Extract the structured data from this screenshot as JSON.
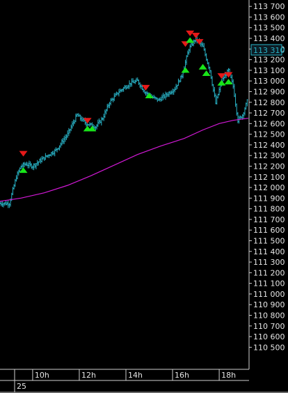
{
  "chart_data": {
    "type": "candlestick",
    "y_axis": {
      "ticks": [
        "113 700",
        "113 600",
        "113 500",
        "113 400",
        "113 300",
        "113 200",
        "113 100",
        "113 000",
        "112 900",
        "112 800",
        "112 700",
        "112 600",
        "112 500",
        "112 400",
        "112 300",
        "112 200",
        "112 100",
        "112 000",
        "111 900",
        "111 800",
        "111 700",
        "111 600",
        "111 500",
        "111 400",
        "111 300",
        "111 200",
        "111 100",
        "111 000",
        "110 900",
        "110 800",
        "110 700",
        "110 600",
        "110 500"
      ],
      "ylim": [
        110450,
        113760
      ]
    },
    "x_axis": {
      "ticks": [
        "10h",
        "12h",
        "14h",
        "16h",
        "18h"
      ],
      "date_label": "25",
      "xlim": [
        8.6,
        19.25
      ]
    },
    "last_price_label": "113 310",
    "colors": {
      "bars": "#29b4c8",
      "moving_average": "#d219d6",
      "buy_signal": "#19e619",
      "sell_signal": "#e61919",
      "axis": "#cfcfcf"
    },
    "moving_average": [
      {
        "t": 8.6,
        "v": 111870
      },
      {
        "t": 9.5,
        "v": 111900
      },
      {
        "t": 10.5,
        "v": 111950
      },
      {
        "t": 11.5,
        "v": 112020
      },
      {
        "t": 12.5,
        "v": 112110
      },
      {
        "t": 13.5,
        "v": 112210
      },
      {
        "t": 14.5,
        "v": 112310
      },
      {
        "t": 15.5,
        "v": 112390
      },
      {
        "t": 16.5,
        "v": 112460
      },
      {
        "t": 17.3,
        "v": 112540
      },
      {
        "t": 18.0,
        "v": 112600
      },
      {
        "t": 18.6,
        "v": 112630
      },
      {
        "t": 19.25,
        "v": 112650
      }
    ],
    "price_path": [
      {
        "t": 8.6,
        "v": 111850
      },
      {
        "t": 9.0,
        "v": 111850
      },
      {
        "t": 9.3,
        "v": 112100
      },
      {
        "t": 9.5,
        "v": 112200
      },
      {
        "t": 9.7,
        "v": 112220
      },
      {
        "t": 10.0,
        "v": 112200
      },
      {
        "t": 10.5,
        "v": 112280
      },
      {
        "t": 11.0,
        "v": 112350
      },
      {
        "t": 11.5,
        "v": 112500
      },
      {
        "t": 11.9,
        "v": 112680
      },
      {
        "t": 12.3,
        "v": 112600
      },
      {
        "t": 12.7,
        "v": 112570
      },
      {
        "t": 13.0,
        "v": 112650
      },
      {
        "t": 13.3,
        "v": 112800
      },
      {
        "t": 13.7,
        "v": 112900
      },
      {
        "t": 14.2,
        "v": 112980
      },
      {
        "t": 14.5,
        "v": 113000
      },
      {
        "t": 14.8,
        "v": 112900
      },
      {
        "t": 15.1,
        "v": 112850
      },
      {
        "t": 15.4,
        "v": 112820
      },
      {
        "t": 15.8,
        "v": 112880
      },
      {
        "t": 16.1,
        "v": 112930
      },
      {
        "t": 16.4,
        "v": 113050
      },
      {
        "t": 16.7,
        "v": 113300
      },
      {
        "t": 17.0,
        "v": 113400
      },
      {
        "t": 17.3,
        "v": 113320
      },
      {
        "t": 17.6,
        "v": 113100
      },
      {
        "t": 17.85,
        "v": 112790
      },
      {
        "t": 18.1,
        "v": 113000
      },
      {
        "t": 18.4,
        "v": 113100
      },
      {
        "t": 18.6,
        "v": 112950
      },
      {
        "t": 18.8,
        "v": 112630
      },
      {
        "t": 19.0,
        "v": 112680
      },
      {
        "t": 19.25,
        "v": 112840
      }
    ],
    "signals": [
      {
        "t": 9.6,
        "v": 112310,
        "type": "sell"
      },
      {
        "t": 9.6,
        "v": 112170,
        "type": "buy"
      },
      {
        "t": 12.35,
        "v": 112620,
        "type": "sell"
      },
      {
        "t": 12.35,
        "v": 112560,
        "type": "buy"
      },
      {
        "t": 12.55,
        "v": 112560,
        "type": "buy"
      },
      {
        "t": 14.85,
        "v": 112930,
        "type": "sell"
      },
      {
        "t": 15.0,
        "v": 112870,
        "type": "buy"
      },
      {
        "t": 16.55,
        "v": 113340,
        "type": "sell"
      },
      {
        "t": 16.55,
        "v": 113110,
        "type": "buy"
      },
      {
        "t": 16.75,
        "v": 113440,
        "type": "sell"
      },
      {
        "t": 16.75,
        "v": 113390,
        "type": "buy"
      },
      {
        "t": 17.0,
        "v": 113420,
        "type": "sell"
      },
      {
        "t": 17.15,
        "v": 113360,
        "type": "sell"
      },
      {
        "t": 17.3,
        "v": 113140,
        "type": "buy"
      },
      {
        "t": 17.45,
        "v": 113080,
        "type": "buy"
      },
      {
        "t": 18.1,
        "v": 113040,
        "type": "sell"
      },
      {
        "t": 18.1,
        "v": 112990,
        "type": "buy"
      },
      {
        "t": 18.4,
        "v": 113050,
        "type": "sell"
      },
      {
        "t": 18.4,
        "v": 113000,
        "type": "buy"
      }
    ]
  }
}
